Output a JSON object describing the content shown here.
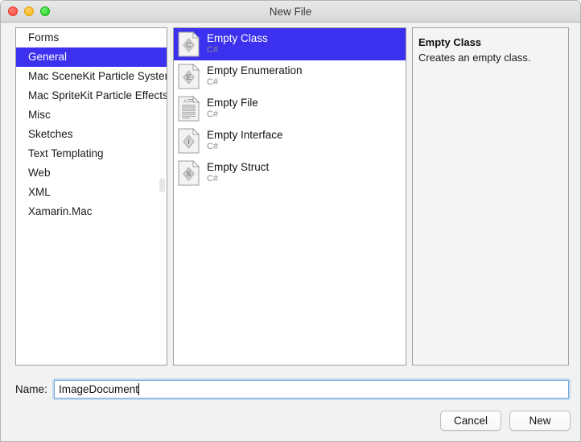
{
  "window": {
    "title": "New File",
    "traffic_lights": [
      {
        "name": "close",
        "color": "#f8453b"
      },
      {
        "name": "minimize",
        "color": "#f6b512"
      },
      {
        "name": "zoom",
        "color": "#1fcd20"
      }
    ]
  },
  "colors": {
    "selection_blue": "#3b31ee",
    "window_bg": "#f2f2f2",
    "panel_border": "#a0a0a0",
    "focus_ring": "#6fa8dc"
  },
  "categories": {
    "items": [
      {
        "label": "Forms",
        "selected": false
      },
      {
        "label": "General",
        "selected": true
      },
      {
        "label": "Mac SceneKit Particle System",
        "selected": false
      },
      {
        "label": "Mac SpriteKit Particle Effects",
        "selected": false
      },
      {
        "label": "Misc",
        "selected": false
      },
      {
        "label": "Sketches",
        "selected": false
      },
      {
        "label": "Text Templating",
        "selected": false
      },
      {
        "label": "Web",
        "selected": false
      },
      {
        "label": "XML",
        "selected": false
      },
      {
        "label": "Xamarin.Mac",
        "selected": false
      }
    ]
  },
  "templates": {
    "items": [
      {
        "title": "Empty Class",
        "subtitle": "C#",
        "icon": "class-file-icon",
        "glyph": "C",
        "selected": true
      },
      {
        "title": "Empty Enumeration",
        "subtitle": "C#",
        "icon": "enum-file-icon",
        "glyph": "E",
        "selected": false
      },
      {
        "title": "Empty File",
        "subtitle": "C#",
        "icon": "text-file-icon",
        "glyph": "",
        "selected": false
      },
      {
        "title": "Empty Interface",
        "subtitle": "C#",
        "icon": "interface-file-icon",
        "glyph": "I",
        "selected": false
      },
      {
        "title": "Empty Struct",
        "subtitle": "C#",
        "icon": "struct-file-icon",
        "glyph": "S",
        "selected": false
      }
    ]
  },
  "description": {
    "title": "Empty Class",
    "body": "Creates an empty class."
  },
  "name_field": {
    "label": "Name:",
    "value": "ImageDocument",
    "placeholder": ""
  },
  "buttons": {
    "cancel": "Cancel",
    "new": "New"
  }
}
